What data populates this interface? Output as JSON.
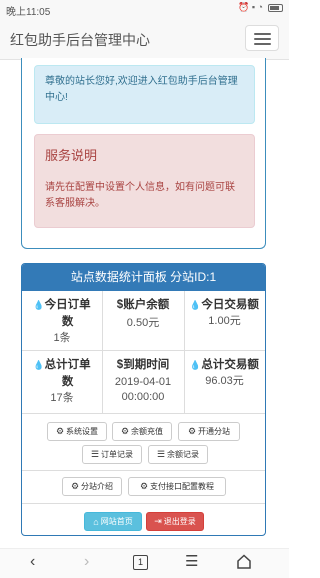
{
  "status_bar": {
    "time": "晚上11:05",
    "icons": "⏰ ▪ ◔"
  },
  "navbar": {
    "brand": "红包助手后台管理中心",
    "menu_icon": "hamburger-icon"
  },
  "welcome_alert": {
    "text": "尊敬的站长您好,欢迎进入红包助手后台管理中心!"
  },
  "service_alert": {
    "title": "服务说明",
    "body": "请先在配置中设置个人信息，如有问题可联系客服解决。"
  },
  "stats_panel": {
    "header": "站点数据统计面板 分站ID:1",
    "cells": [
      {
        "icon": "💧",
        "label": "今日订单数",
        "value": "1条"
      },
      {
        "icon": "$",
        "label": "账户余额",
        "value": "0.50元"
      },
      {
        "icon": "💧",
        "label": "今日交易额",
        "value": "1.00元"
      },
      {
        "icon": "💧",
        "label": "总计订单数",
        "value": "17条"
      },
      {
        "icon": "$",
        "label": "到期时间",
        "value": "2019-04-01 00:00:00"
      },
      {
        "icon": "💧",
        "label": "总计交易额",
        "value": "96.03元"
      }
    ],
    "buttons": {
      "system_settings": "系统设置",
      "balance_recharge": "余额充值",
      "open_substation": "开通分站",
      "order_records": "订单记录",
      "balance_records": "余额记录",
      "substation_intro": "分站介绍",
      "payment_tutorial": "支付接口配置教程",
      "site_home": "网站首页",
      "logout": "退出登录"
    }
  },
  "bottom_nav": {
    "page_number": "1"
  }
}
